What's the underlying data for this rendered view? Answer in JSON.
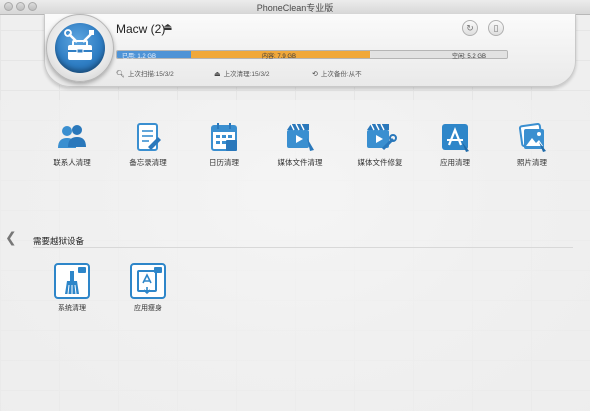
{
  "window": {
    "title": "PhoneClean专业版"
  },
  "device": {
    "name": "Macw (2)",
    "storage": [
      {
        "label": "已用: 1.2 GB",
        "fraction": 0.19,
        "color": "#4e93d6"
      },
      {
        "label": "内容: 7.9 GB",
        "fraction": 0.46,
        "color": "#f0a83a"
      },
      {
        "label": "空闲: 5.2 GB",
        "fraction": 0.35,
        "color": "#e2e2e2"
      }
    ],
    "last_scan": "上次扫描:15/3/2",
    "last_clean": "上次清理:15/3/2",
    "last_backup": "上次备份:从不"
  },
  "tools": [
    {
      "label": "联系人清理",
      "icon": "contacts-icon"
    },
    {
      "label": "备忘录清理",
      "icon": "notes-icon"
    },
    {
      "label": "日历清理",
      "icon": "calendar-icon"
    },
    {
      "label": "媒体文件清理",
      "icon": "media-clean-icon"
    },
    {
      "label": "媒体文件修复",
      "icon": "media-repair-icon"
    },
    {
      "label": "应用清理",
      "icon": "app-store-icon"
    },
    {
      "label": "照片清理",
      "icon": "photos-icon"
    }
  ],
  "jailbreak": {
    "section_title": "需要越狱设备",
    "items": [
      {
        "label": "系统清理",
        "icon": "system-clean-icon"
      },
      {
        "label": "应用瘦身",
        "icon": "app-slim-icon"
      }
    ]
  },
  "colors": {
    "accent": "#2e86c9",
    "used": "#4e93d6",
    "content": "#f0a83a"
  }
}
